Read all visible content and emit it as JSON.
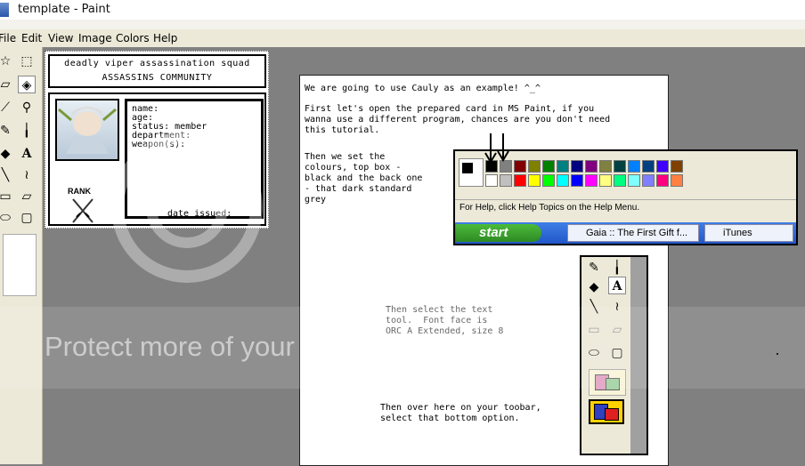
{
  "window": {
    "title": "template - Paint"
  },
  "menu": {
    "items": [
      "File",
      "Edit",
      "View",
      "Image",
      "Colors",
      "Help"
    ]
  },
  "card": {
    "header_line1": "deadly viper assassination squad",
    "header_line2": "ASSASSINS COMMUNITY",
    "fields": [
      "name:",
      "age:",
      "status: member",
      "department:",
      "weapon(s):"
    ],
    "date_issued": "date issued:",
    "rank_label": "RANK"
  },
  "tutorial": {
    "intro": "We are going to use Cauly as an example! ^_^",
    "step1": "First let's open the prepared card in MS Paint, if you\nwanna use a different program, chances are you don't need\nthis tutorial.",
    "step2": "Then we set the\ncolours, top box -\nblack and the back one\n- that dark standard\ngrey",
    "step3": "Then select the text\ntool.  Font face is\nORC A Extended, size 8",
    "step4": "Then over here on your toobar,\nselect that bottom option."
  },
  "palette_shot": {
    "help_text": "For Help, click Help Topics on the Help Menu.",
    "start_label": "start",
    "task1": "Gaia :: The First Gift f...",
    "task2": "iTunes",
    "colors_top": [
      "#000000",
      "#808080",
      "#800000",
      "#808000",
      "#008000",
      "#008080",
      "#000080",
      "#800080",
      "#808040",
      "#004040",
      "#0080ff",
      "#004080",
      "#4000ff",
      "#804000"
    ],
    "colors_bottom": [
      "#ffffff",
      "#c0c0c0",
      "#ff0000",
      "#ffff00",
      "#00ff00",
      "#00ffff",
      "#0000ff",
      "#ff00ff",
      "#ffff80",
      "#00ff80",
      "#80ffff",
      "#8080ff",
      "#ff0080",
      "#ff8040"
    ]
  },
  "watermark": {
    "text": "Protect more of your memories for less!"
  }
}
